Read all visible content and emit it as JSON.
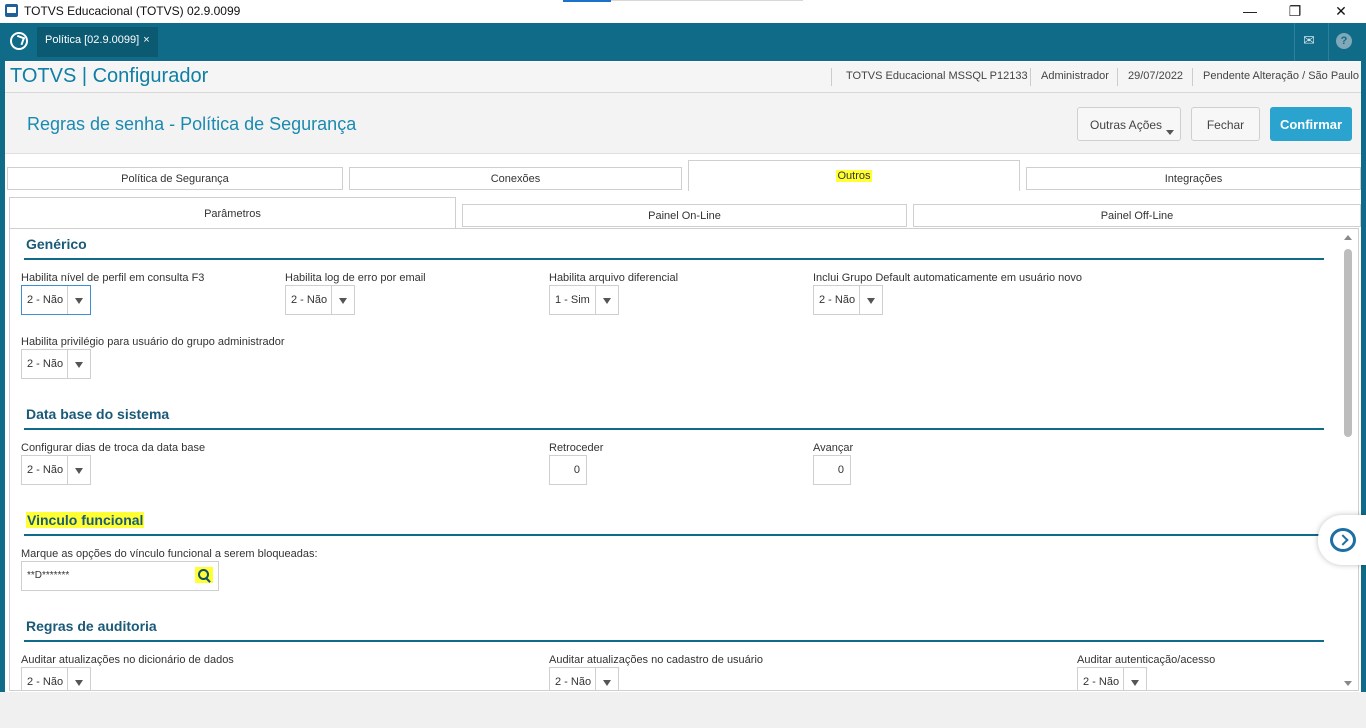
{
  "window": {
    "title": "TOTVS Educacional (TOTVS) 02.9.0099",
    "minimize": "—",
    "restore": "❐",
    "close": "✕"
  },
  "appbar": {
    "tab_label": "Política [02.9.0099]",
    "tab_close": "×",
    "mail_icon": "✉",
    "help_icon": "?"
  },
  "header": {
    "brand": "TOTVS | Configurador",
    "environment": "TOTVS Educacional MSSQL P12133",
    "user": "Administrador",
    "date": "29/07/2022",
    "status": "Pendente Alteração / São Paulo"
  },
  "page": {
    "title": "Regras de senha - Política de Segurança",
    "more_actions": "Outras Ações",
    "close": "Fechar",
    "confirm": "Confirmar"
  },
  "tabs": [
    "Política de Segurança",
    "Conexões",
    "Outros",
    "Integrações"
  ],
  "subtabs": [
    "Parâmetros",
    "Painel On-Line",
    "Painel Off-Line"
  ],
  "sections": {
    "generico": "Genérico",
    "database": "Data base do sistema",
    "vinculo": "Vinculo funcional",
    "auditoria": "Regras de auditoria"
  },
  "fields": {
    "perfil_f3": {
      "label": "Habilita nível de perfil em consulta F3",
      "value": "2 - Não"
    },
    "log_email": {
      "label": "Habilita log de erro por email",
      "value": "2 - Não"
    },
    "arquivo_dif": {
      "label": "Habilita arquivo diferencial",
      "value": "1 - Sim"
    },
    "grupo_default": {
      "label": "Inclui Grupo Default automaticamente em usuário novo",
      "value": "2 - Não"
    },
    "privilegio_admin": {
      "label": "Habilita privilégio para usuário do grupo administrador",
      "value": "2 - Não"
    },
    "dias_troca": {
      "label": "Configurar dias de troca da data base",
      "value": "2 - Não"
    },
    "retroceder": {
      "label": "Retroceder",
      "value": "0"
    },
    "avancar": {
      "label": "Avançar",
      "value": "0"
    },
    "vinculo_opcoes": {
      "label": "Marque as opções do vínculo funcional a serem bloqueadas:",
      "value": "**D*******"
    },
    "audit_dicionario": {
      "label": "Auditar atualizações no dicionário de dados",
      "value": "2 - Não"
    },
    "audit_usuario": {
      "label": "Auditar atualizações no cadastro de usuário",
      "value": "2 - Não"
    },
    "audit_acesso": {
      "label": "Auditar autenticação/acesso",
      "value": "2 - Não"
    }
  }
}
